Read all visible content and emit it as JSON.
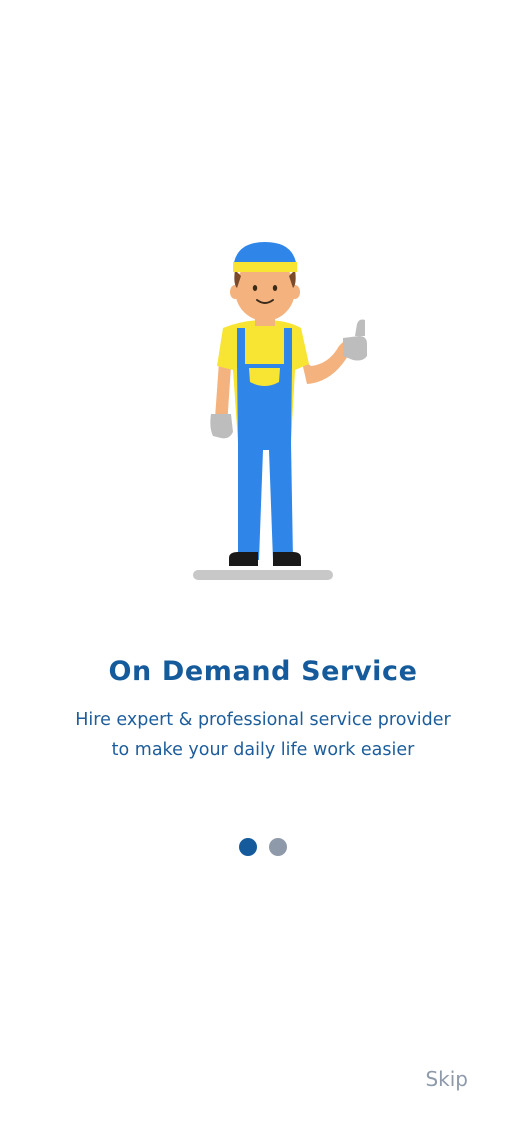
{
  "onboarding": {
    "title": "On Demand Service",
    "description_line1": "Hire expert & professional service provider",
    "description_line2": "to make your daily life work easier",
    "skip_label": "Skip",
    "pagination": {
      "total_pages": 2,
      "current_page": 1
    }
  },
  "colors": {
    "primary": "#155b9b",
    "inactive_dot": "#8e9aaa",
    "skip_text": "#8e9aaa",
    "overall_blue": "#2f86e8",
    "shirt_yellow": "#f7e433",
    "cap_blue": "#2f86e8",
    "skin": "#f4b27e",
    "glove_grey": "#bdbdbd",
    "ground_grey": "#c8c8c8"
  },
  "icons": {
    "illustration": "worker-thumbs-up-illustration"
  }
}
